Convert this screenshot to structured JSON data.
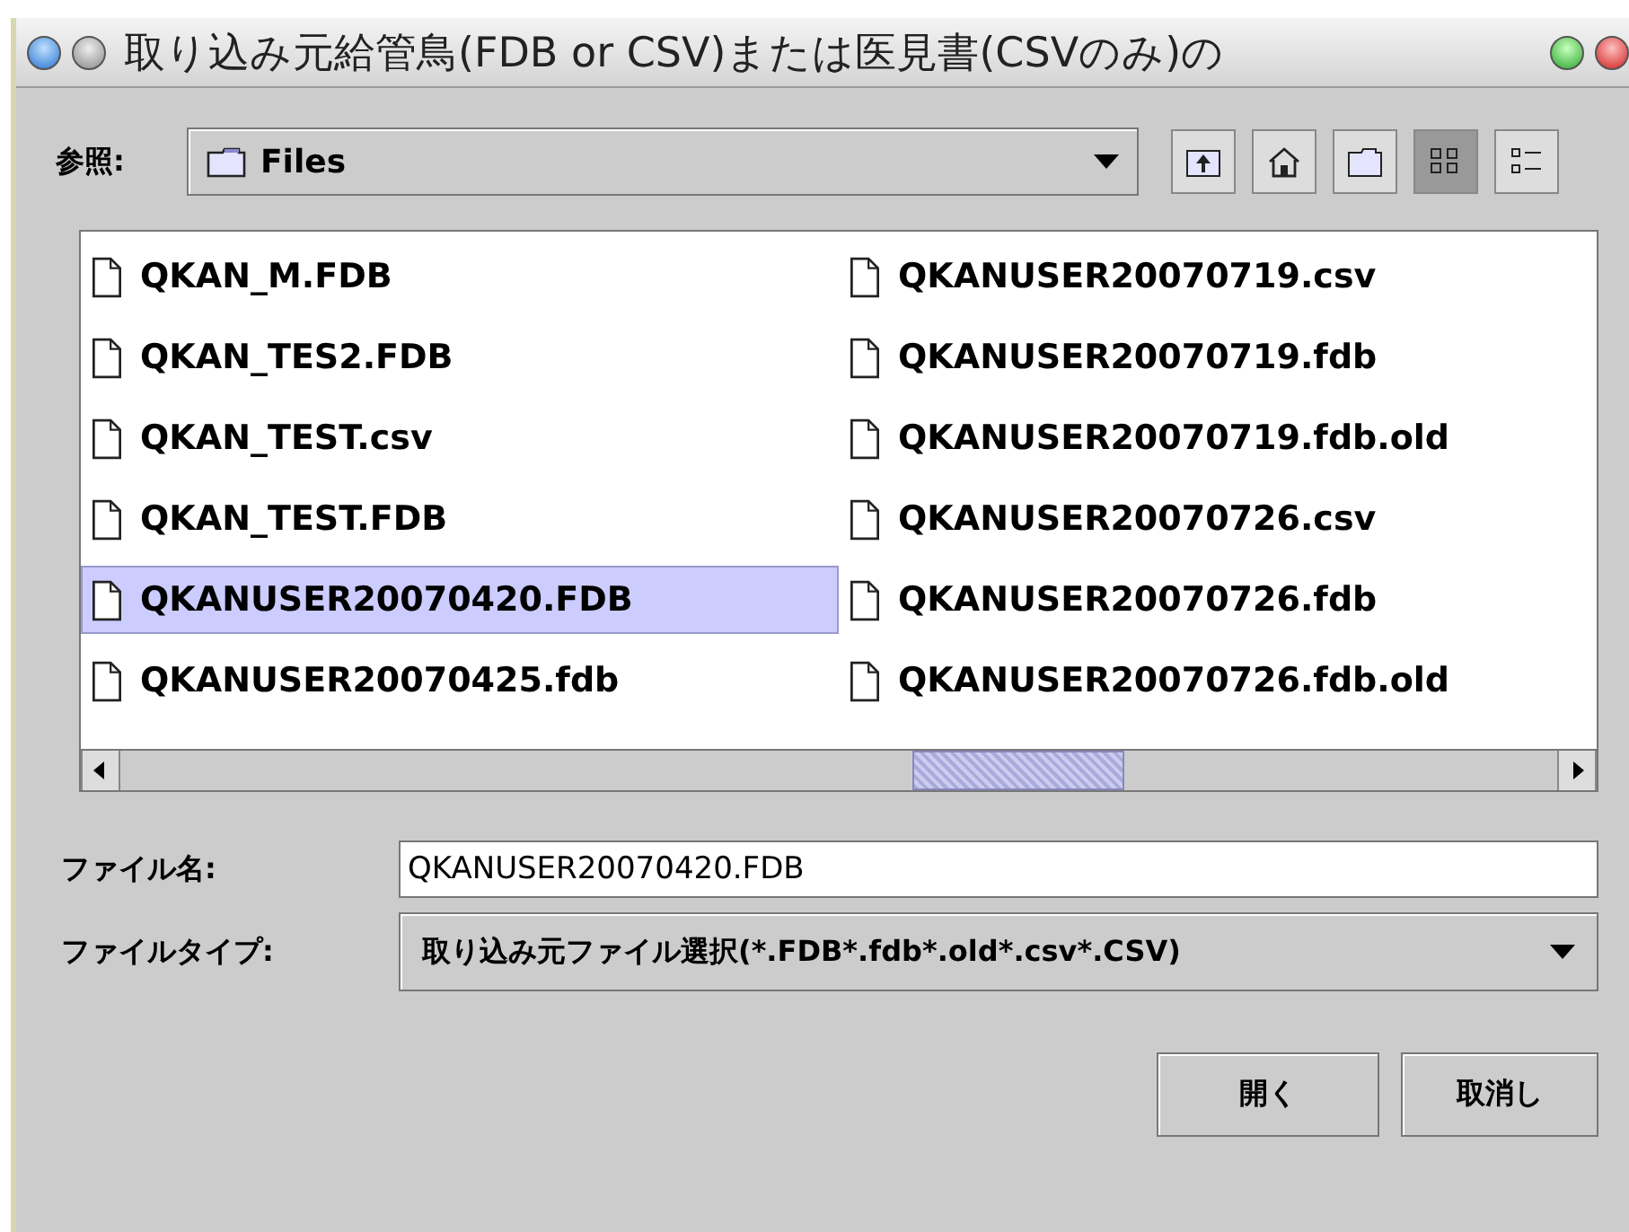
{
  "window": {
    "title": "取り込み元給管鳥(FDB or CSV)または医見書(CSVのみ)の"
  },
  "look_in": {
    "label": "参照:",
    "value": "Files"
  },
  "toolbar": [
    {
      "kind": "up",
      "selected": false
    },
    {
      "kind": "home",
      "selected": false
    },
    {
      "kind": "newfolder",
      "selected": false
    },
    {
      "kind": "list",
      "selected": true
    },
    {
      "kind": "details",
      "selected": false
    }
  ],
  "files": [
    {
      "name": "QKAN_M.FDB",
      "selected": false
    },
    {
      "name": "QKAN_TES2.FDB",
      "selected": false
    },
    {
      "name": "QKAN_TEST.csv",
      "selected": false
    },
    {
      "name": "QKAN_TEST.FDB",
      "selected": false
    },
    {
      "name": "QKANUSER20070420.FDB",
      "selected": true
    },
    {
      "name": "QKANUSER20070425.fdb",
      "selected": false
    },
    {
      "name": "QKANUSER20070719.csv",
      "selected": false
    },
    {
      "name": "QKANUSER20070719.fdb",
      "selected": false
    },
    {
      "name": "QKANUSER20070719.fdb.old",
      "selected": false
    },
    {
      "name": "QKANUSER20070726.csv",
      "selected": false
    },
    {
      "name": "QKANUSER20070726.fdb",
      "selected": false
    },
    {
      "name": "QKANUSER20070726.fdb.old",
      "selected": false
    }
  ],
  "file_name": {
    "label": "ファイル名:",
    "value": "QKANUSER20070420.FDB"
  },
  "file_type": {
    "label": "ファイルタイプ:",
    "value": "取り込み元ファイル選択(*.FDB*.fdb*.old*.csv*.CSV)"
  },
  "buttons": [
    "開く",
    "取消し"
  ]
}
